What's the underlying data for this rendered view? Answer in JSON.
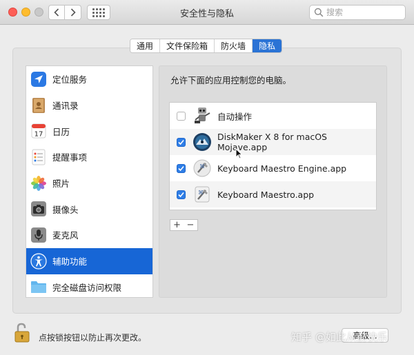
{
  "window": {
    "title": "安全性与隐私"
  },
  "search": {
    "placeholder": "搜索"
  },
  "tabs": [
    {
      "label": "通用",
      "active": false
    },
    {
      "label": "文件保险箱",
      "active": false
    },
    {
      "label": "防火墙",
      "active": false
    },
    {
      "label": "隐私",
      "active": true
    }
  ],
  "sidebar": {
    "items": [
      {
        "label": "定位服务",
        "icon": "location-arrow-icon"
      },
      {
        "label": "通讯录",
        "icon": "contacts-book-icon"
      },
      {
        "label": "日历",
        "icon": "calendar-icon",
        "calendar_day": "17"
      },
      {
        "label": "提醒事项",
        "icon": "reminders-list-icon"
      },
      {
        "label": "照片",
        "icon": "photos-flower-icon"
      },
      {
        "label": "摄像头",
        "icon": "camera-icon"
      },
      {
        "label": "麦克风",
        "icon": "microphone-icon"
      },
      {
        "label": "辅助功能",
        "icon": "accessibility-icon",
        "selected": true
      },
      {
        "label": "完全磁盘访问权限",
        "icon": "folder-icon"
      }
    ]
  },
  "main": {
    "description": "允许下面的应用控制您的电脑。",
    "apps": [
      {
        "name": "自动操作",
        "checked": false,
        "icon": "automator-robot-icon"
      },
      {
        "name": "DiskMaker X 8 for macOS Mojave.app",
        "checked": true,
        "icon": "diskmaker-icon"
      },
      {
        "name": "Keyboard Maestro Engine.app",
        "checked": true,
        "icon": "keyboard-maestro-engine-icon"
      },
      {
        "name": "Keyboard Maestro.app",
        "checked": true,
        "icon": "keyboard-maestro-icon"
      }
    ],
    "add_label": "+",
    "remove_label": "−"
  },
  "footer": {
    "lock_text": "点按锁按钮以防止再次更改。",
    "advanced_label": "高级...",
    "watermark": "知乎 @如此从前快乐"
  },
  "colors": {
    "accent": "#1766d6",
    "checkbox": "#2f7ee6"
  }
}
